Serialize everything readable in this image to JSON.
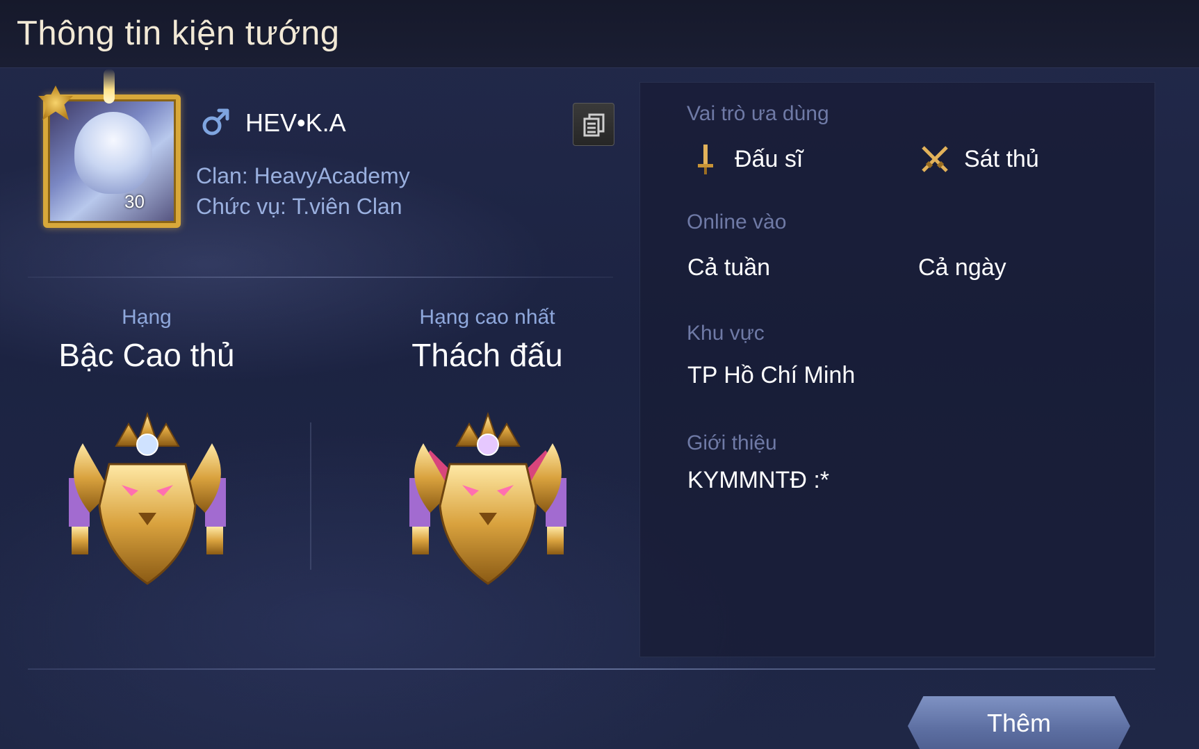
{
  "header": {
    "title": "Thông tin kiện tướng"
  },
  "profile": {
    "name": "HEV•K.A",
    "gender_icon": "male-icon",
    "level": "30",
    "clan": "Clan: HeavyAcademy",
    "clan_role": "Chức vụ: T.viên Clan",
    "copy_icon": "copy-icon"
  },
  "ranks": {
    "current": {
      "label": "Hạng",
      "value": "Bậc Cao thủ",
      "icon": "gold-lion-emblem-icon"
    },
    "highest": {
      "label": "Hạng cao nhất",
      "value": "Thách đấu",
      "icon": "gold-lion-emblem-pink-icon"
    }
  },
  "details": {
    "preferred_roles": {
      "label": "Vai trò ưa dùng",
      "items": [
        {
          "name": "Đấu sĩ",
          "icon": "sword-icon"
        },
        {
          "name": "Sát thủ",
          "icon": "crossed-daggers-icon"
        }
      ]
    },
    "online": {
      "label": "Online vào",
      "days": "Cả tuần",
      "hours": "Cả ngày"
    },
    "region": {
      "label": "Khu vực",
      "value": "TP Hồ Chí Minh"
    },
    "intro": {
      "label": "Giới thiệu",
      "value": "KYMMNTĐ :*"
    }
  },
  "footer": {
    "more_button": "Thêm"
  },
  "colors": {
    "background": "#1f2746",
    "title_text": "#f2e9d6",
    "accent_blue": "#9ab0df",
    "muted_label": "#6f7aa6",
    "gold": "#d8a83a",
    "button": "#6b7db0"
  }
}
